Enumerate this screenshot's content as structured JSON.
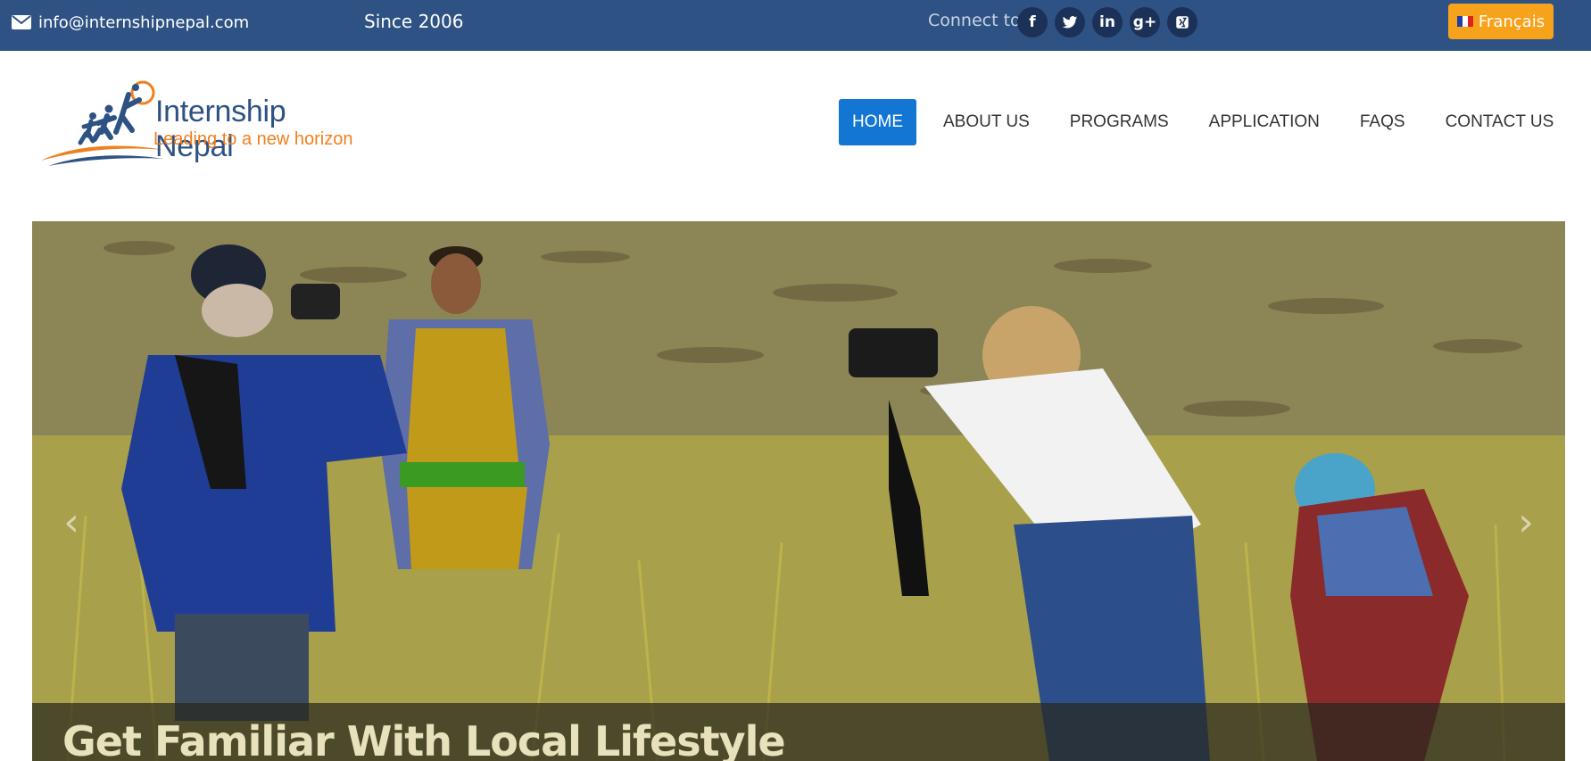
{
  "topbar": {
    "email": "info@internshipnepal.com",
    "since": "Since 2006",
    "connect_label": "Connect to:",
    "socials": [
      {
        "icon": "facebook-icon",
        "glyph": "f"
      },
      {
        "icon": "twitter-icon",
        "glyph": ""
      },
      {
        "icon": "linkedin-icon",
        "glyph": "in"
      },
      {
        "icon": "google-plus-icon",
        "glyph": "g+"
      },
      {
        "icon": "xing-icon",
        "glyph": ""
      }
    ],
    "language": "Français"
  },
  "header": {
    "logo_title": "Internship Nepal",
    "logo_tagline": "Leading to a new horizon",
    "nav": [
      "HOME",
      "ABOUT US",
      "PROGRAMS",
      "APPLICATION",
      "FAQS",
      "CONTACT US"
    ],
    "active_nav": "HOME"
  },
  "hero": {
    "caption": "Get Familiar With Local Lifestyle",
    "prev_icon": "chevron-left-icon",
    "next_icon": "chevron-right-icon"
  },
  "colors": {
    "topbar": "#2e5283",
    "language_button": "#f7a21b",
    "nav_active": "#1476d3",
    "logo_blue": "#2e5283",
    "logo_orange": "#f07f1e"
  }
}
